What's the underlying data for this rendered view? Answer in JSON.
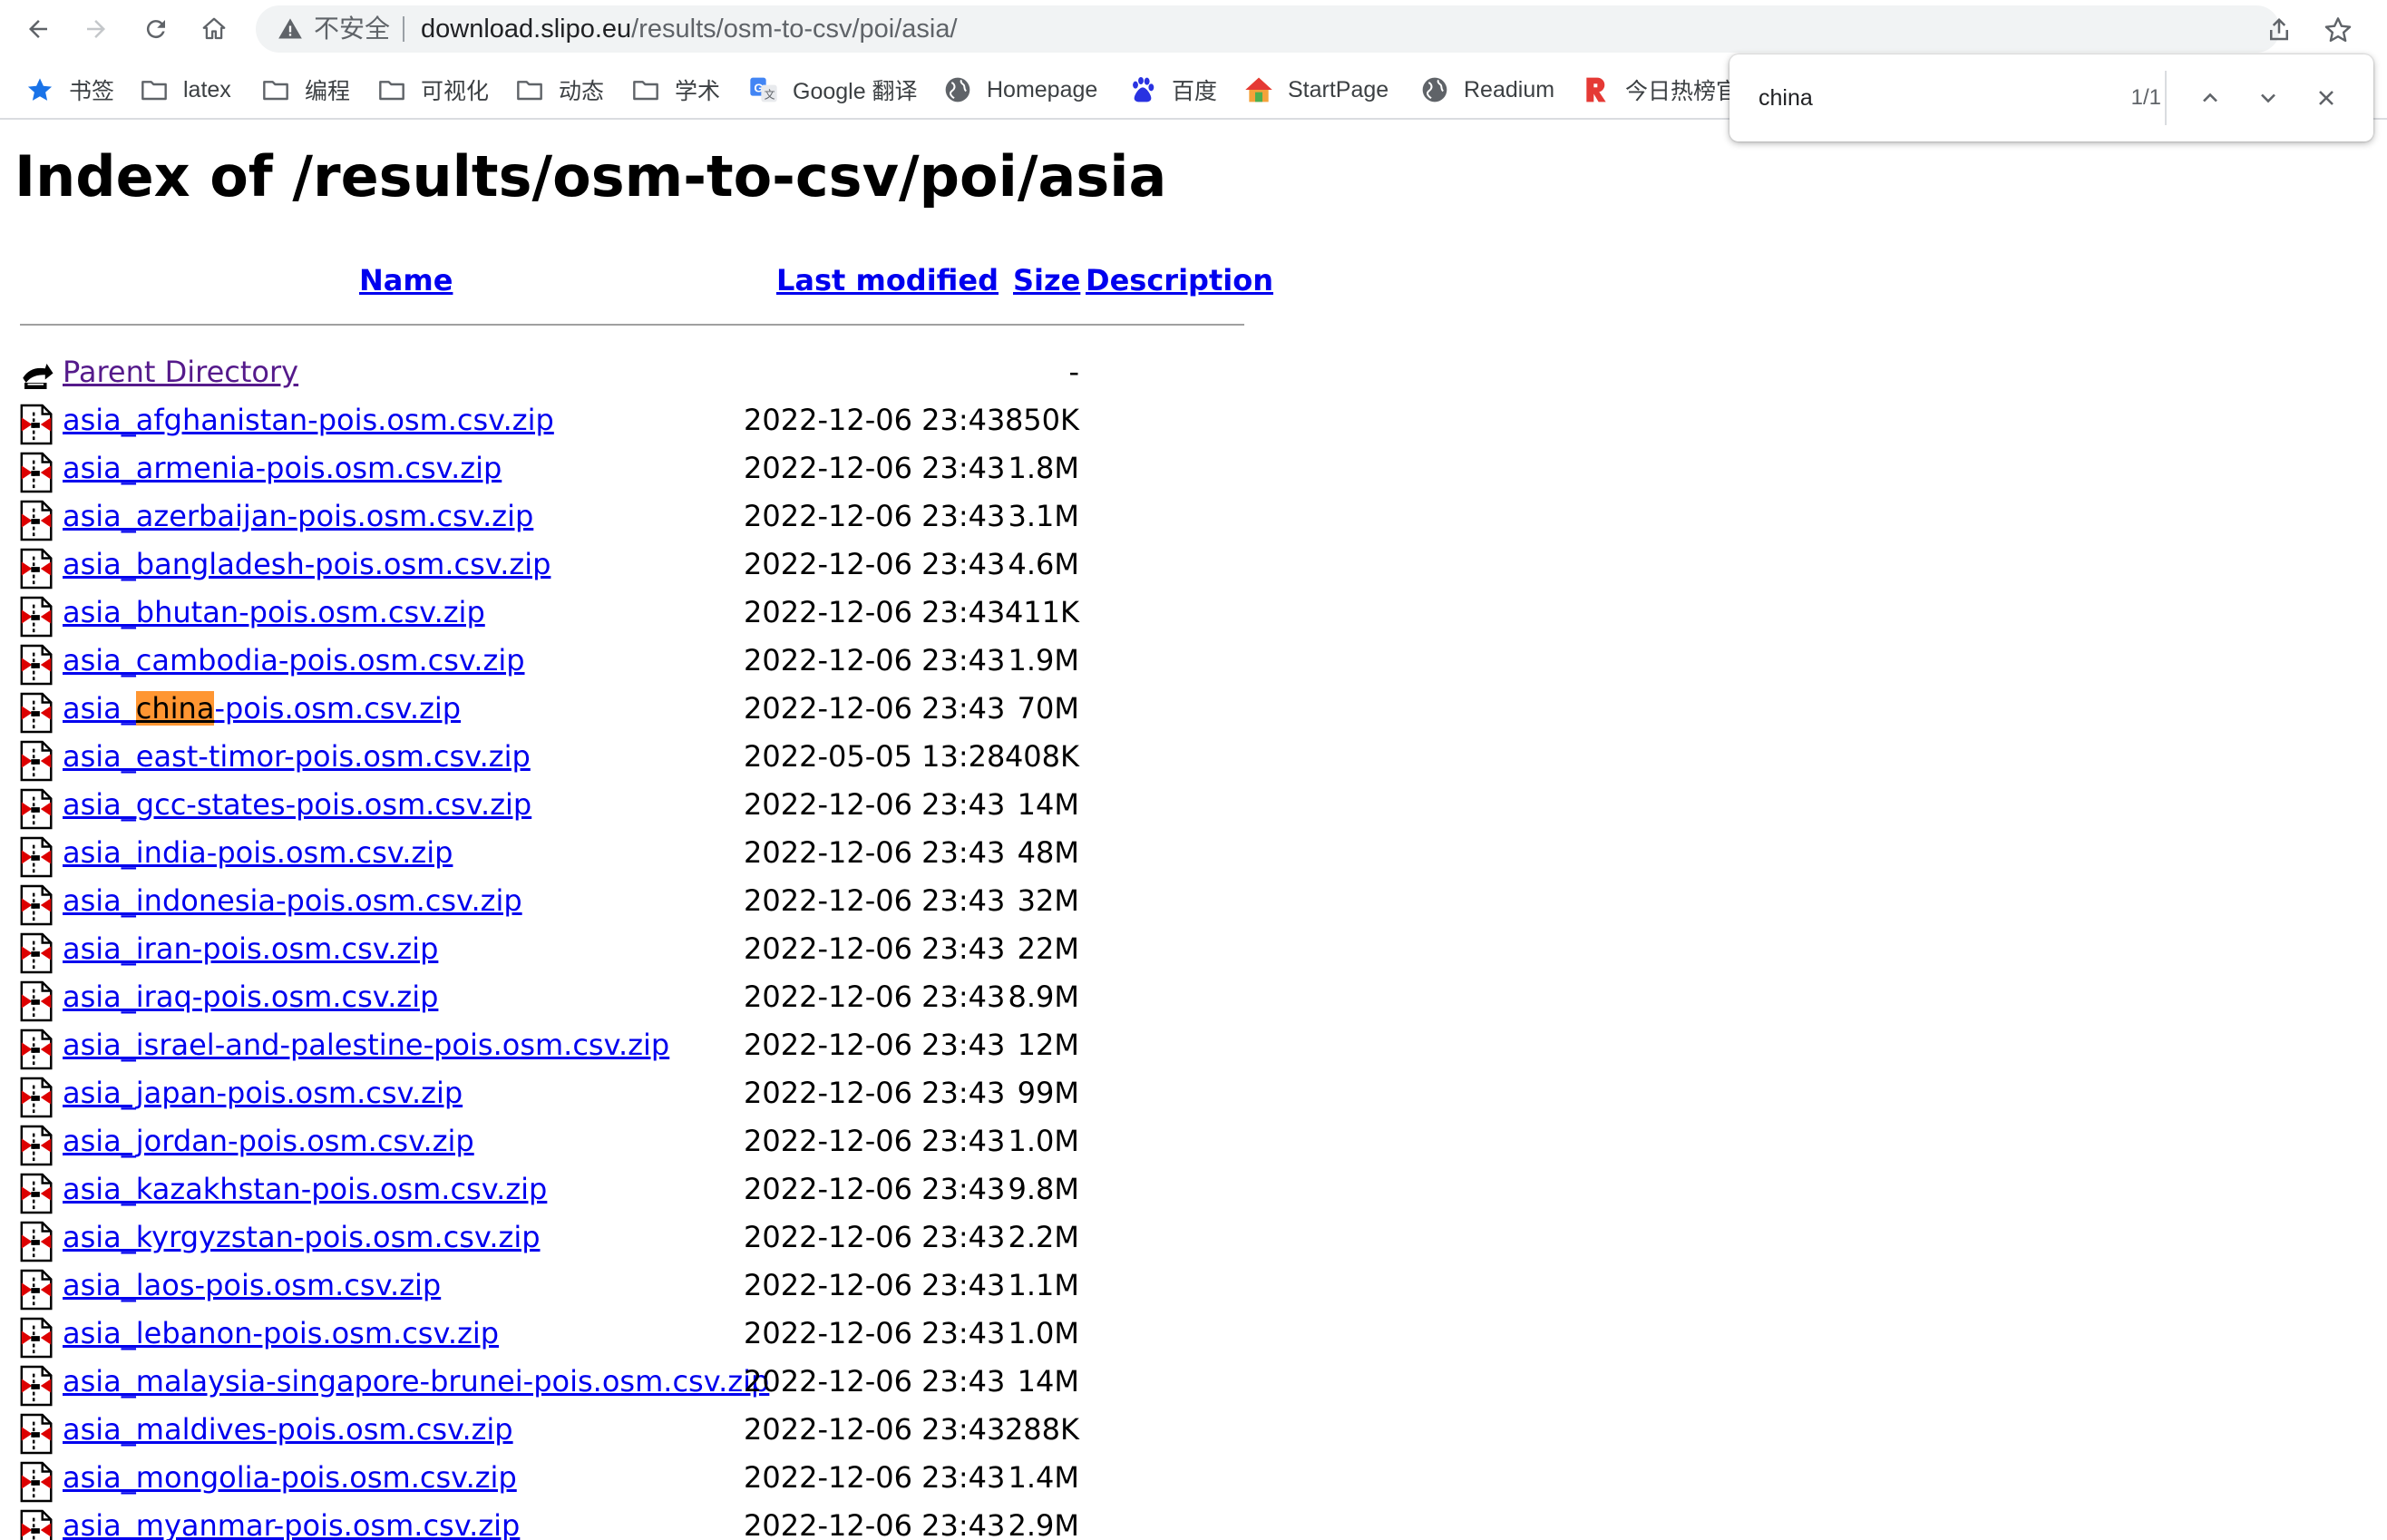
{
  "browser": {
    "security_label": "不安全",
    "url_host": "download.slipo.eu",
    "url_path": "/results/osm-to-csv/poi/asia/"
  },
  "bookmarks": [
    {
      "label": "书签",
      "icon": "star-icon"
    },
    {
      "label": "latex",
      "icon": "folder-icon"
    },
    {
      "label": "编程",
      "icon": "folder-icon"
    },
    {
      "label": "可视化",
      "icon": "folder-icon"
    },
    {
      "label": "动态",
      "icon": "folder-icon"
    },
    {
      "label": "学术",
      "icon": "folder-icon"
    },
    {
      "label": "Google 翻译",
      "icon": "google-translate-icon"
    },
    {
      "label": "Homepage",
      "icon": "globe-icon"
    },
    {
      "label": "百度",
      "icon": "baidu-icon"
    },
    {
      "label": "StartPage",
      "icon": "house-icon"
    },
    {
      "label": "Readium",
      "icon": "globe-icon"
    },
    {
      "label": "今日热榜官",
      "icon": "r-logo-icon"
    }
  ],
  "find_bar": {
    "query": "china",
    "count": "1/1"
  },
  "page": {
    "title": "Index of /results/osm-to-csv/poi/asia",
    "headers": {
      "name": "Name",
      "last_modified": "Last modified",
      "size": "Size",
      "description": "Description"
    },
    "parent": {
      "name": "Parent Directory",
      "size": "-"
    },
    "highlight_term": "china",
    "files": [
      {
        "name": "asia_afghanistan-pois.osm.csv.zip",
        "modified": "2022-12-06 23:43",
        "size": "850K"
      },
      {
        "name": "asia_armenia-pois.osm.csv.zip",
        "modified": "2022-12-06 23:43",
        "size": "1.8M"
      },
      {
        "name": "asia_azerbaijan-pois.osm.csv.zip",
        "modified": "2022-12-06 23:43",
        "size": "3.1M"
      },
      {
        "name": "asia_bangladesh-pois.osm.csv.zip",
        "modified": "2022-12-06 23:43",
        "size": "4.6M"
      },
      {
        "name": "asia_bhutan-pois.osm.csv.zip",
        "modified": "2022-12-06 23:43",
        "size": "411K"
      },
      {
        "name": "asia_cambodia-pois.osm.csv.zip",
        "modified": "2022-12-06 23:43",
        "size": "1.9M"
      },
      {
        "name": "asia_china-pois.osm.csv.zip",
        "modified": "2022-12-06 23:43",
        "size": "70M"
      },
      {
        "name": "asia_east-timor-pois.osm.csv.zip",
        "modified": "2022-05-05 13:28",
        "size": "408K"
      },
      {
        "name": "asia_gcc-states-pois.osm.csv.zip",
        "modified": "2022-12-06 23:43",
        "size": "14M"
      },
      {
        "name": "asia_india-pois.osm.csv.zip",
        "modified": "2022-12-06 23:43",
        "size": "48M"
      },
      {
        "name": "asia_indonesia-pois.osm.csv.zip",
        "modified": "2022-12-06 23:43",
        "size": "32M"
      },
      {
        "name": "asia_iran-pois.osm.csv.zip",
        "modified": "2022-12-06 23:43",
        "size": "22M"
      },
      {
        "name": "asia_iraq-pois.osm.csv.zip",
        "modified": "2022-12-06 23:43",
        "size": "8.9M"
      },
      {
        "name": "asia_israel-and-palestine-pois.osm.csv.zip",
        "modified": "2022-12-06 23:43",
        "size": "12M"
      },
      {
        "name": "asia_japan-pois.osm.csv.zip",
        "modified": "2022-12-06 23:43",
        "size": "99M"
      },
      {
        "name": "asia_jordan-pois.osm.csv.zip",
        "modified": "2022-12-06 23:43",
        "size": "1.0M"
      },
      {
        "name": "asia_kazakhstan-pois.osm.csv.zip",
        "modified": "2022-12-06 23:43",
        "size": "9.8M"
      },
      {
        "name": "asia_kyrgyzstan-pois.osm.csv.zip",
        "modified": "2022-12-06 23:43",
        "size": "2.2M"
      },
      {
        "name": "asia_laos-pois.osm.csv.zip",
        "modified": "2022-12-06 23:43",
        "size": "1.1M"
      },
      {
        "name": "asia_lebanon-pois.osm.csv.zip",
        "modified": "2022-12-06 23:43",
        "size": "1.0M"
      },
      {
        "name": "asia_malaysia-singapore-brunei-pois.osm.csv.zip",
        "modified": "2022-12-06 23:43",
        "size": "14M"
      },
      {
        "name": "asia_maldives-pois.osm.csv.zip",
        "modified": "2022-12-06 23:43",
        "size": "288K"
      },
      {
        "name": "asia_mongolia-pois.osm.csv.zip",
        "modified": "2022-12-06 23:43",
        "size": "1.4M"
      },
      {
        "name": "asia_myanmar-pois.osm.csv.zip",
        "modified": "2022-12-06 23:43",
        "size": "2.9M"
      }
    ]
  }
}
